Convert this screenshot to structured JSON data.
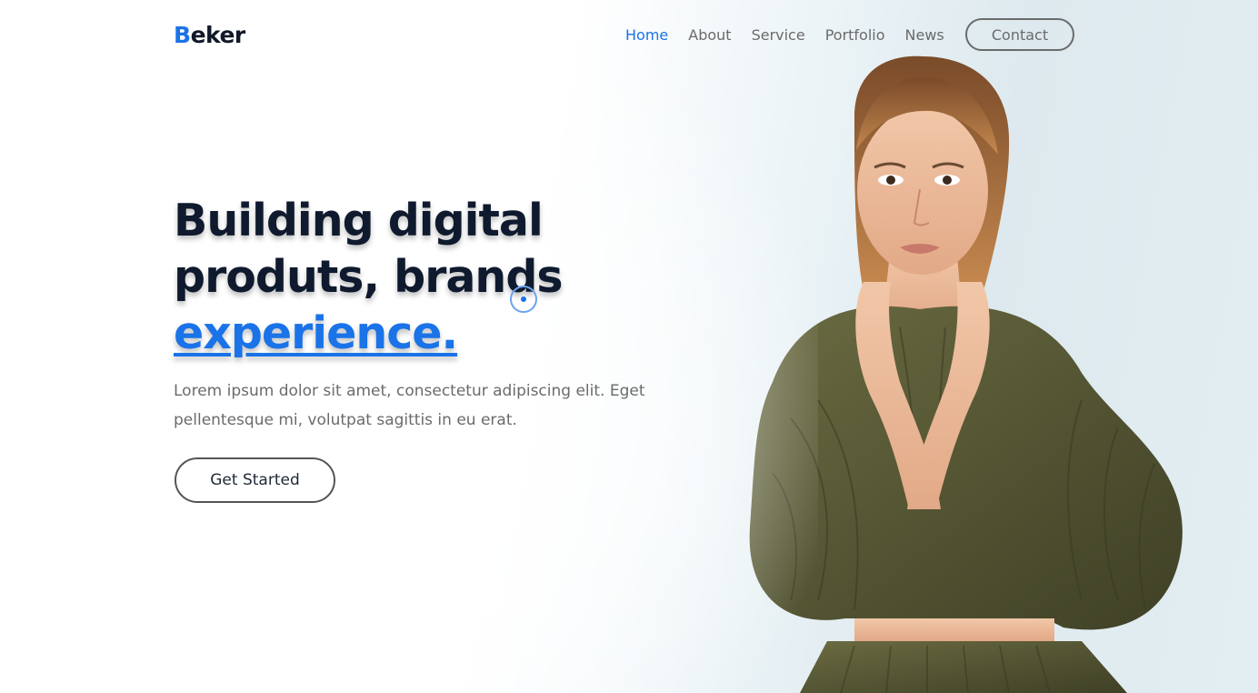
{
  "header": {
    "logo_initial": "B",
    "logo_rest": "eker",
    "nav": [
      {
        "label": "Home",
        "active": true
      },
      {
        "label": "About",
        "active": false
      },
      {
        "label": "Service",
        "active": false
      },
      {
        "label": "Portfolio",
        "active": false
      },
      {
        "label": "News",
        "active": false
      }
    ],
    "contact_label": "Contact"
  },
  "hero": {
    "title_line1": "Building digital",
    "title_line2": "produts, brands",
    "title_highlight": "experience.",
    "description": "Lorem ipsum dolor sit amet, consectetur adipiscing elit. Eget pellentesque mi, volutpat sagittis in eu erat.",
    "cta_label": "Get Started"
  },
  "colors": {
    "accent": "#1a73e8",
    "heading": "#0f1a2e",
    "muted": "#6b6b6b",
    "dress": "#5a5a35"
  }
}
